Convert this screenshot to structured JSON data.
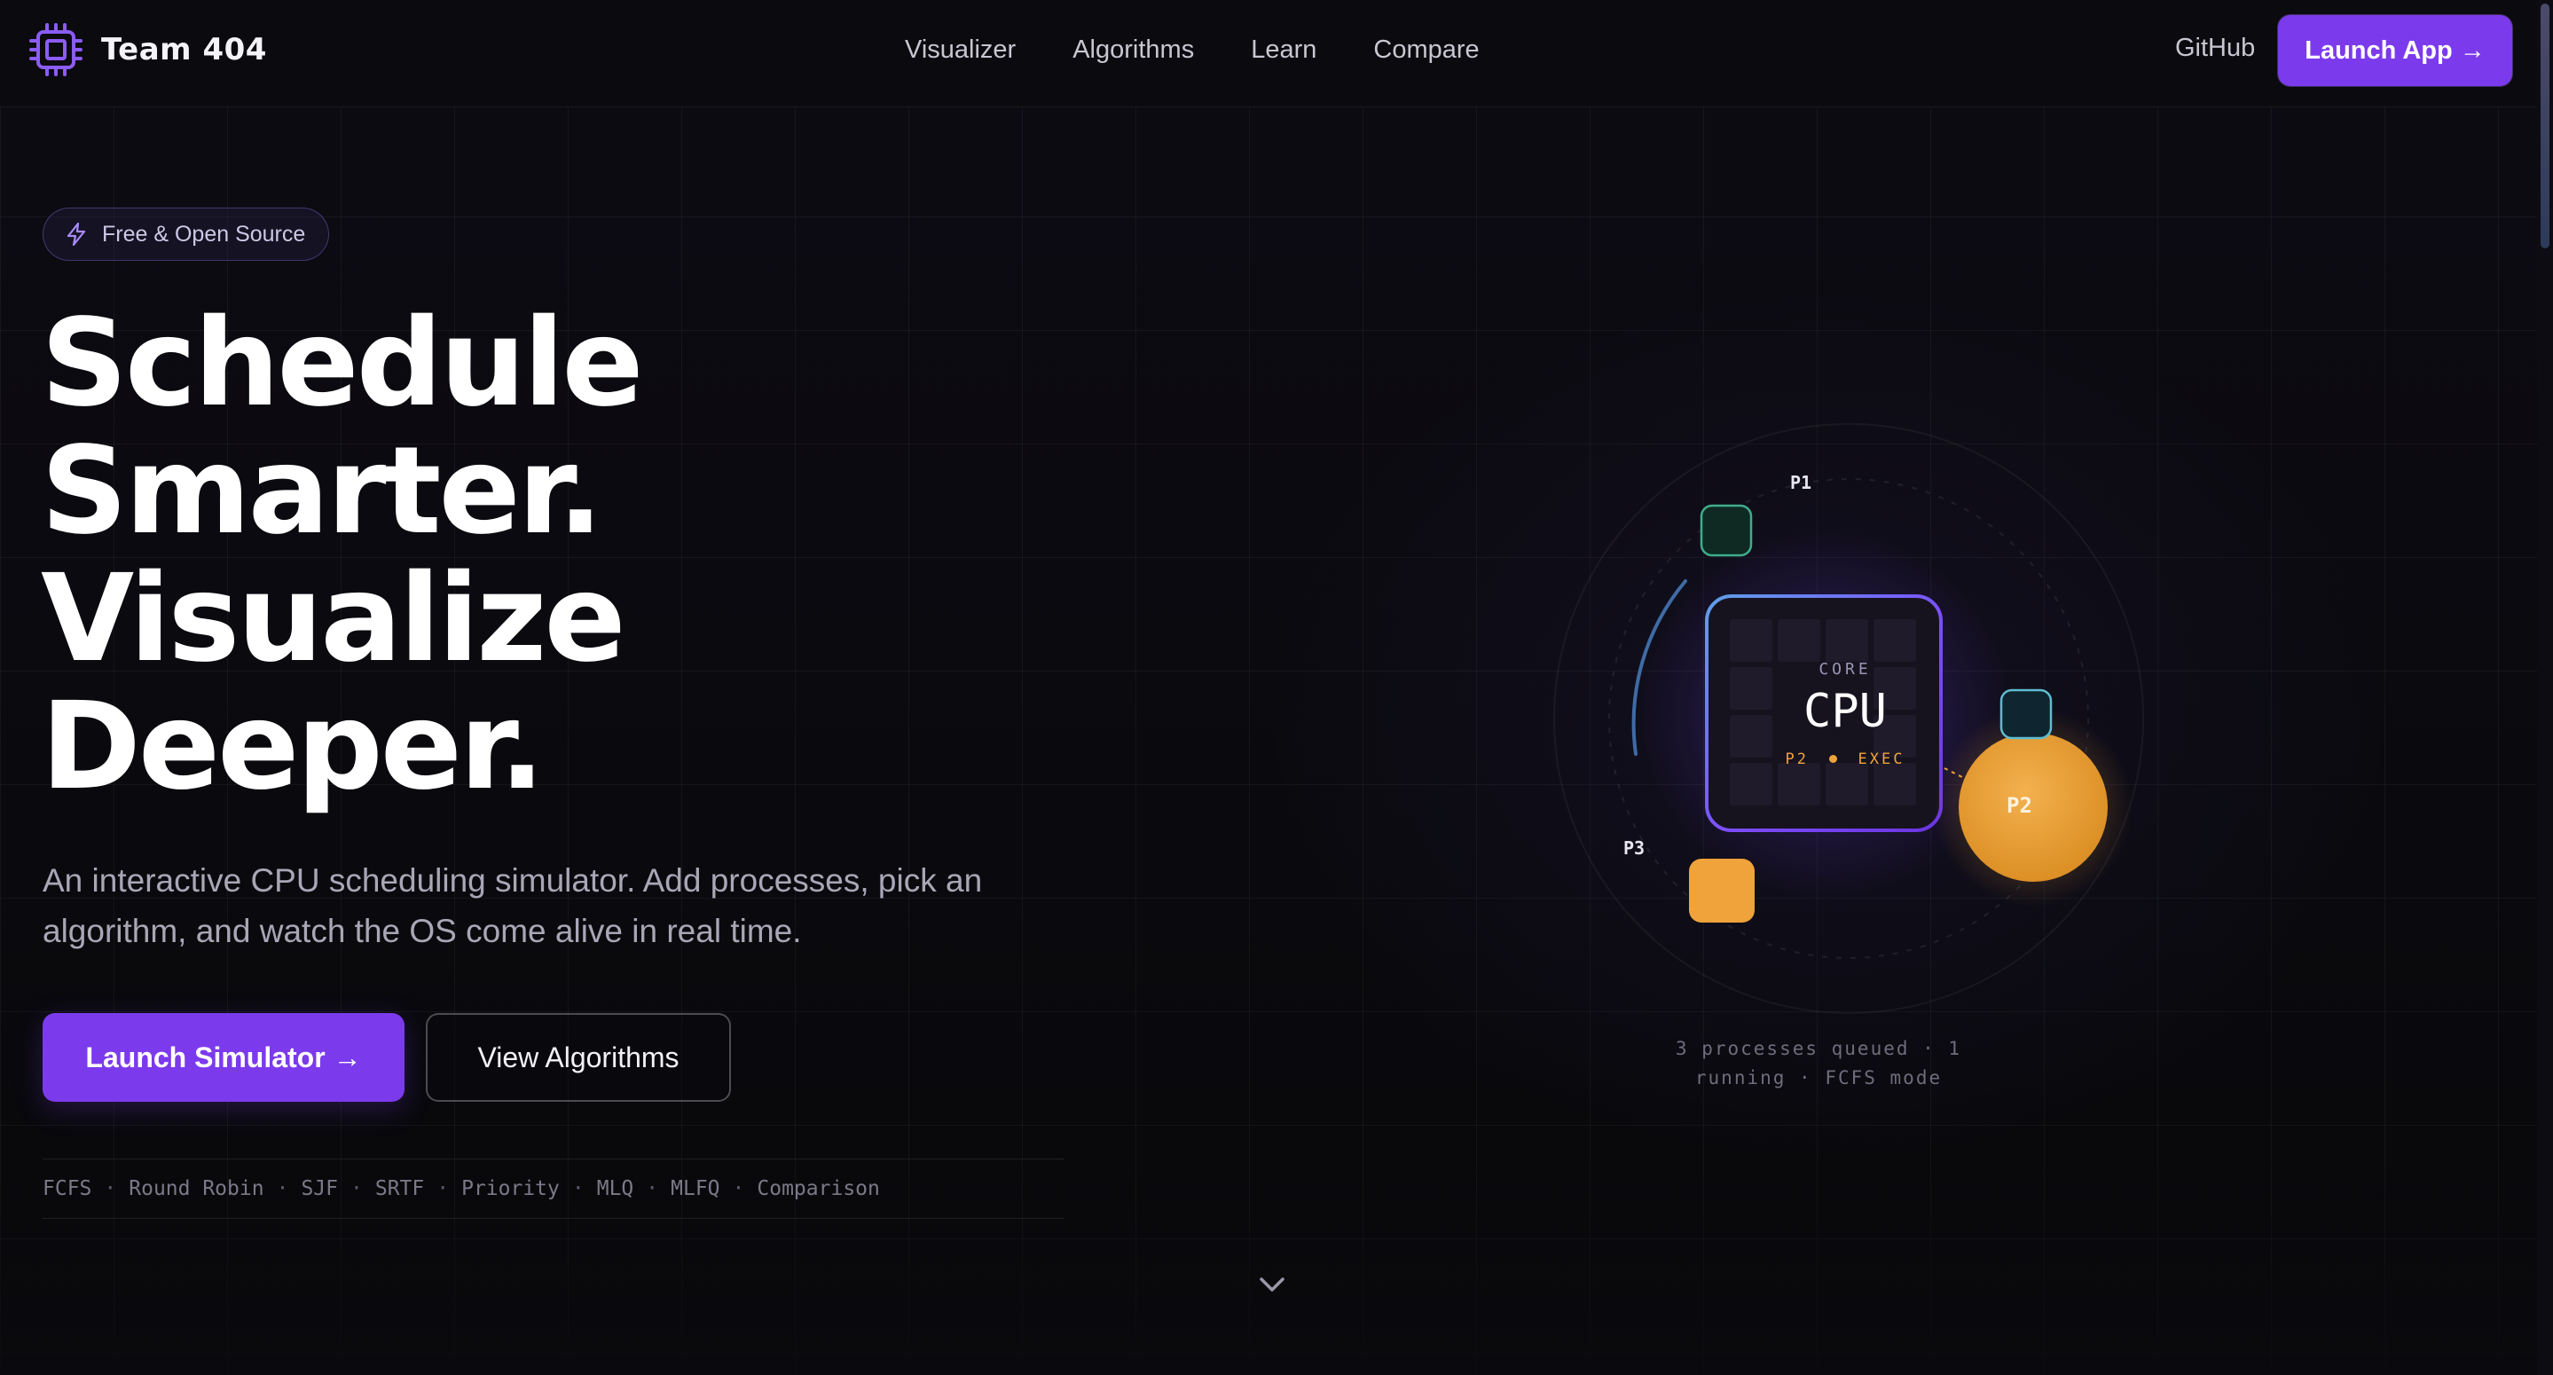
{
  "nav": {
    "brand": "Team 404",
    "links": [
      "Visualizer",
      "Algorithms",
      "Learn",
      "Compare"
    ],
    "github": "GitHub",
    "launch": "Launch App →"
  },
  "hero": {
    "badge": "Free & Open Source",
    "headline": [
      "Schedule",
      "Smarter.",
      "Visualize",
      "Deeper."
    ],
    "subtitle": "An interactive CPU scheduling simulator. Add processes, pick an algorithm, and watch the OS come alive in real time.",
    "primary_cta": "Launch Simulator →",
    "secondary_cta": "View Algorithms",
    "algorithms": [
      "FCFS",
      "Round Robin",
      "SJF",
      "SRTF",
      "Priority",
      "MLQ",
      "MLFQ",
      "Comparison"
    ],
    "separator": "·"
  },
  "visual": {
    "cpu_core": "CORE",
    "cpu_title": "CPU",
    "cpu_exec_process": "P2",
    "cpu_exec_state": "EXEC",
    "processes": [
      "P1",
      "P2",
      "P3"
    ],
    "status_line1": "3 processes queued · 1",
    "status_line2": "running · FCFS mode"
  },
  "colors": {
    "accent": "#7c3aed",
    "running": "#f0a33a",
    "p1": "#3fae8a",
    "queue": "#5fbcd0"
  },
  "icons": {
    "brand": "cpu-chip-icon",
    "badge": "lightning-icon",
    "scroll": "chevron-down-icon"
  }
}
